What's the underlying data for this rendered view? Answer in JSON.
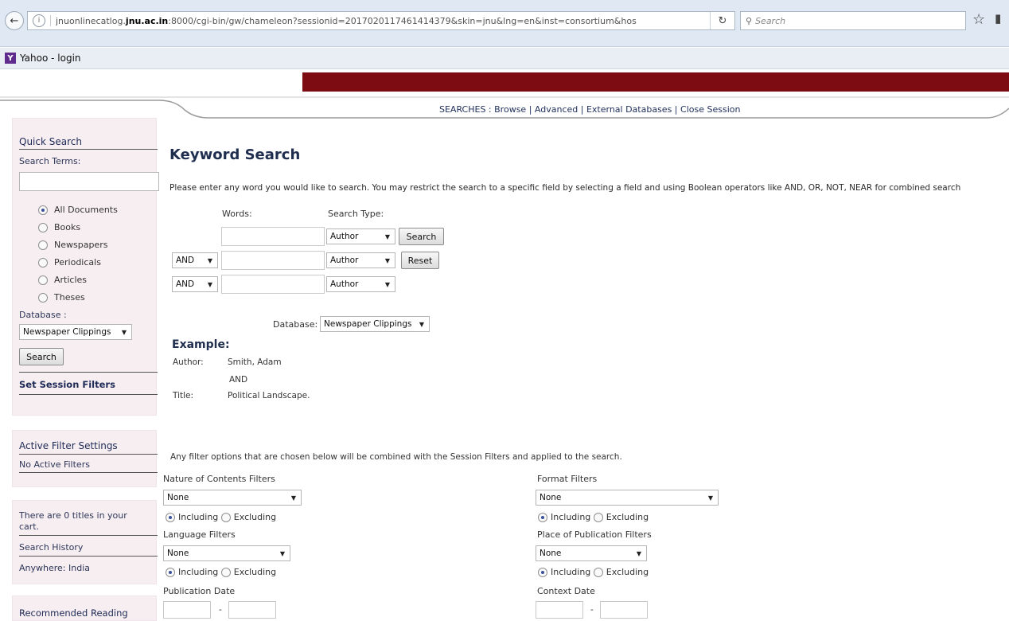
{
  "browser": {
    "url_prefix": "jnuonlinecatlog.",
    "url_domain": "jnu.ac.in",
    "url_rest": ":8000/cgi-bin/gw/chameleon?sessionid=2017020117461414379&skin=jnu&lng=en&inst=consortium&hos",
    "search_placeholder": "Search",
    "bookmark_label": "Yahoo - login",
    "bookmark_icon_letter": "Y"
  },
  "nav": {
    "prefix": "SEARCHES : ",
    "links": [
      "Browse",
      "Advanced",
      "External Databases",
      "Close Session"
    ],
    "separator": " | "
  },
  "sidebar": {
    "quick_search_title": "Quick Search",
    "search_terms_label": "Search Terms:",
    "doc_types": [
      "All Documents",
      "Books",
      "Newspapers",
      "Periodicals",
      "Articles",
      "Theses"
    ],
    "selected_doc_type": "All Documents",
    "database_label": "Database :",
    "database_value": "Newspaper Clippings",
    "search_button": "Search",
    "set_filters_link": "Set Session Filters",
    "active_filter_title": "Active Filter Settings",
    "active_filter_value": "No Active Filters",
    "cart_text_1": "There are 0 titles in your",
    "cart_text_2": "cart.",
    "search_history": "Search History",
    "anywhere": "Anywhere: India",
    "recommended": "Recommended Reading"
  },
  "main": {
    "title": "Keyword Search",
    "intro": "Please enter any word you would like to search. You may restrict the search to a specific field by selecting a field and using Boolean operators like AND, OR, NOT, NEAR for combined search",
    "words_label": "Words:",
    "search_type_label": "Search Type:",
    "rows": [
      {
        "operator": "",
        "type": "Author"
      },
      {
        "operator": "AND",
        "type": "Author"
      },
      {
        "operator": "AND",
        "type": "Author"
      }
    ],
    "search_button": "Search",
    "reset_button": "Reset",
    "database_label": "Database:",
    "database_value": "Newspaper Clippings",
    "example_title": "Example:",
    "example_author_label": "Author:",
    "example_author_value": "Smith, Adam",
    "example_and": "AND",
    "example_title_label": "Title:",
    "example_title_value": "Political Landscape.",
    "filter_intro": "Any filter options that are chosen below will be combined with the Session Filters and applied to the search.",
    "filters": {
      "nature_label": "Nature of Contents Filters",
      "nature_value": "None",
      "format_label": "Format Filters",
      "format_value": "None",
      "language_label": "Language Filters",
      "language_value": "None",
      "place_label": "Place of Publication Filters",
      "place_value": "None",
      "including": "Including",
      "excluding": "Excluding",
      "pubdate_label": "Publication Date",
      "context_label": "Context Date",
      "date_separator": "-"
    }
  }
}
